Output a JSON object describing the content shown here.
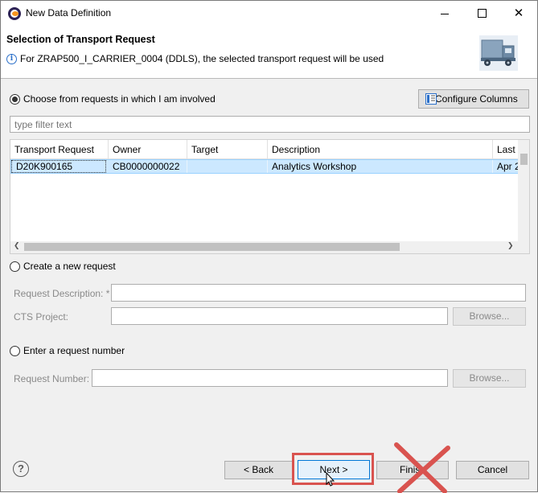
{
  "window": {
    "title": "New Data Definition"
  },
  "header": {
    "title": "Selection of Transport Request",
    "message": "For ZRAP500_I_CARRIER_0004 (DDLS), the selected transport request will be used"
  },
  "options": {
    "choose_label": "Choose from requests in which I am involved",
    "configure_columns_label": "Configure Columns",
    "filter_placeholder": "type filter text",
    "create_label": "Create a new request",
    "request_description_label": "Request Description: *",
    "cts_project_label": "CTS Project:",
    "browse_label": "Browse...",
    "enter_number_label": "Enter a request number",
    "request_number_label": "Request Number:"
  },
  "table": {
    "columns": [
      "Transport Request",
      "Owner",
      "Target",
      "Description",
      "Last"
    ],
    "rows": [
      {
        "transport_request": "D20K900165",
        "owner": "CB0000000022",
        "target": "",
        "description": "Analytics Workshop",
        "last": "Apr 2"
      }
    ]
  },
  "footer": {
    "back_label": "< Back",
    "next_label": "Next >",
    "finish_label": "Finish",
    "cancel_label": "Cancel"
  },
  "colors": {
    "highlight": "#d9534f",
    "selection": "#cce8ff"
  },
  "icons": [
    "eclipse-icon",
    "minimize-icon",
    "maximize-icon",
    "close-icon",
    "info-icon",
    "transport-truck-icon",
    "configure-columns-icon",
    "help-icon",
    "cross-out-mark"
  ]
}
